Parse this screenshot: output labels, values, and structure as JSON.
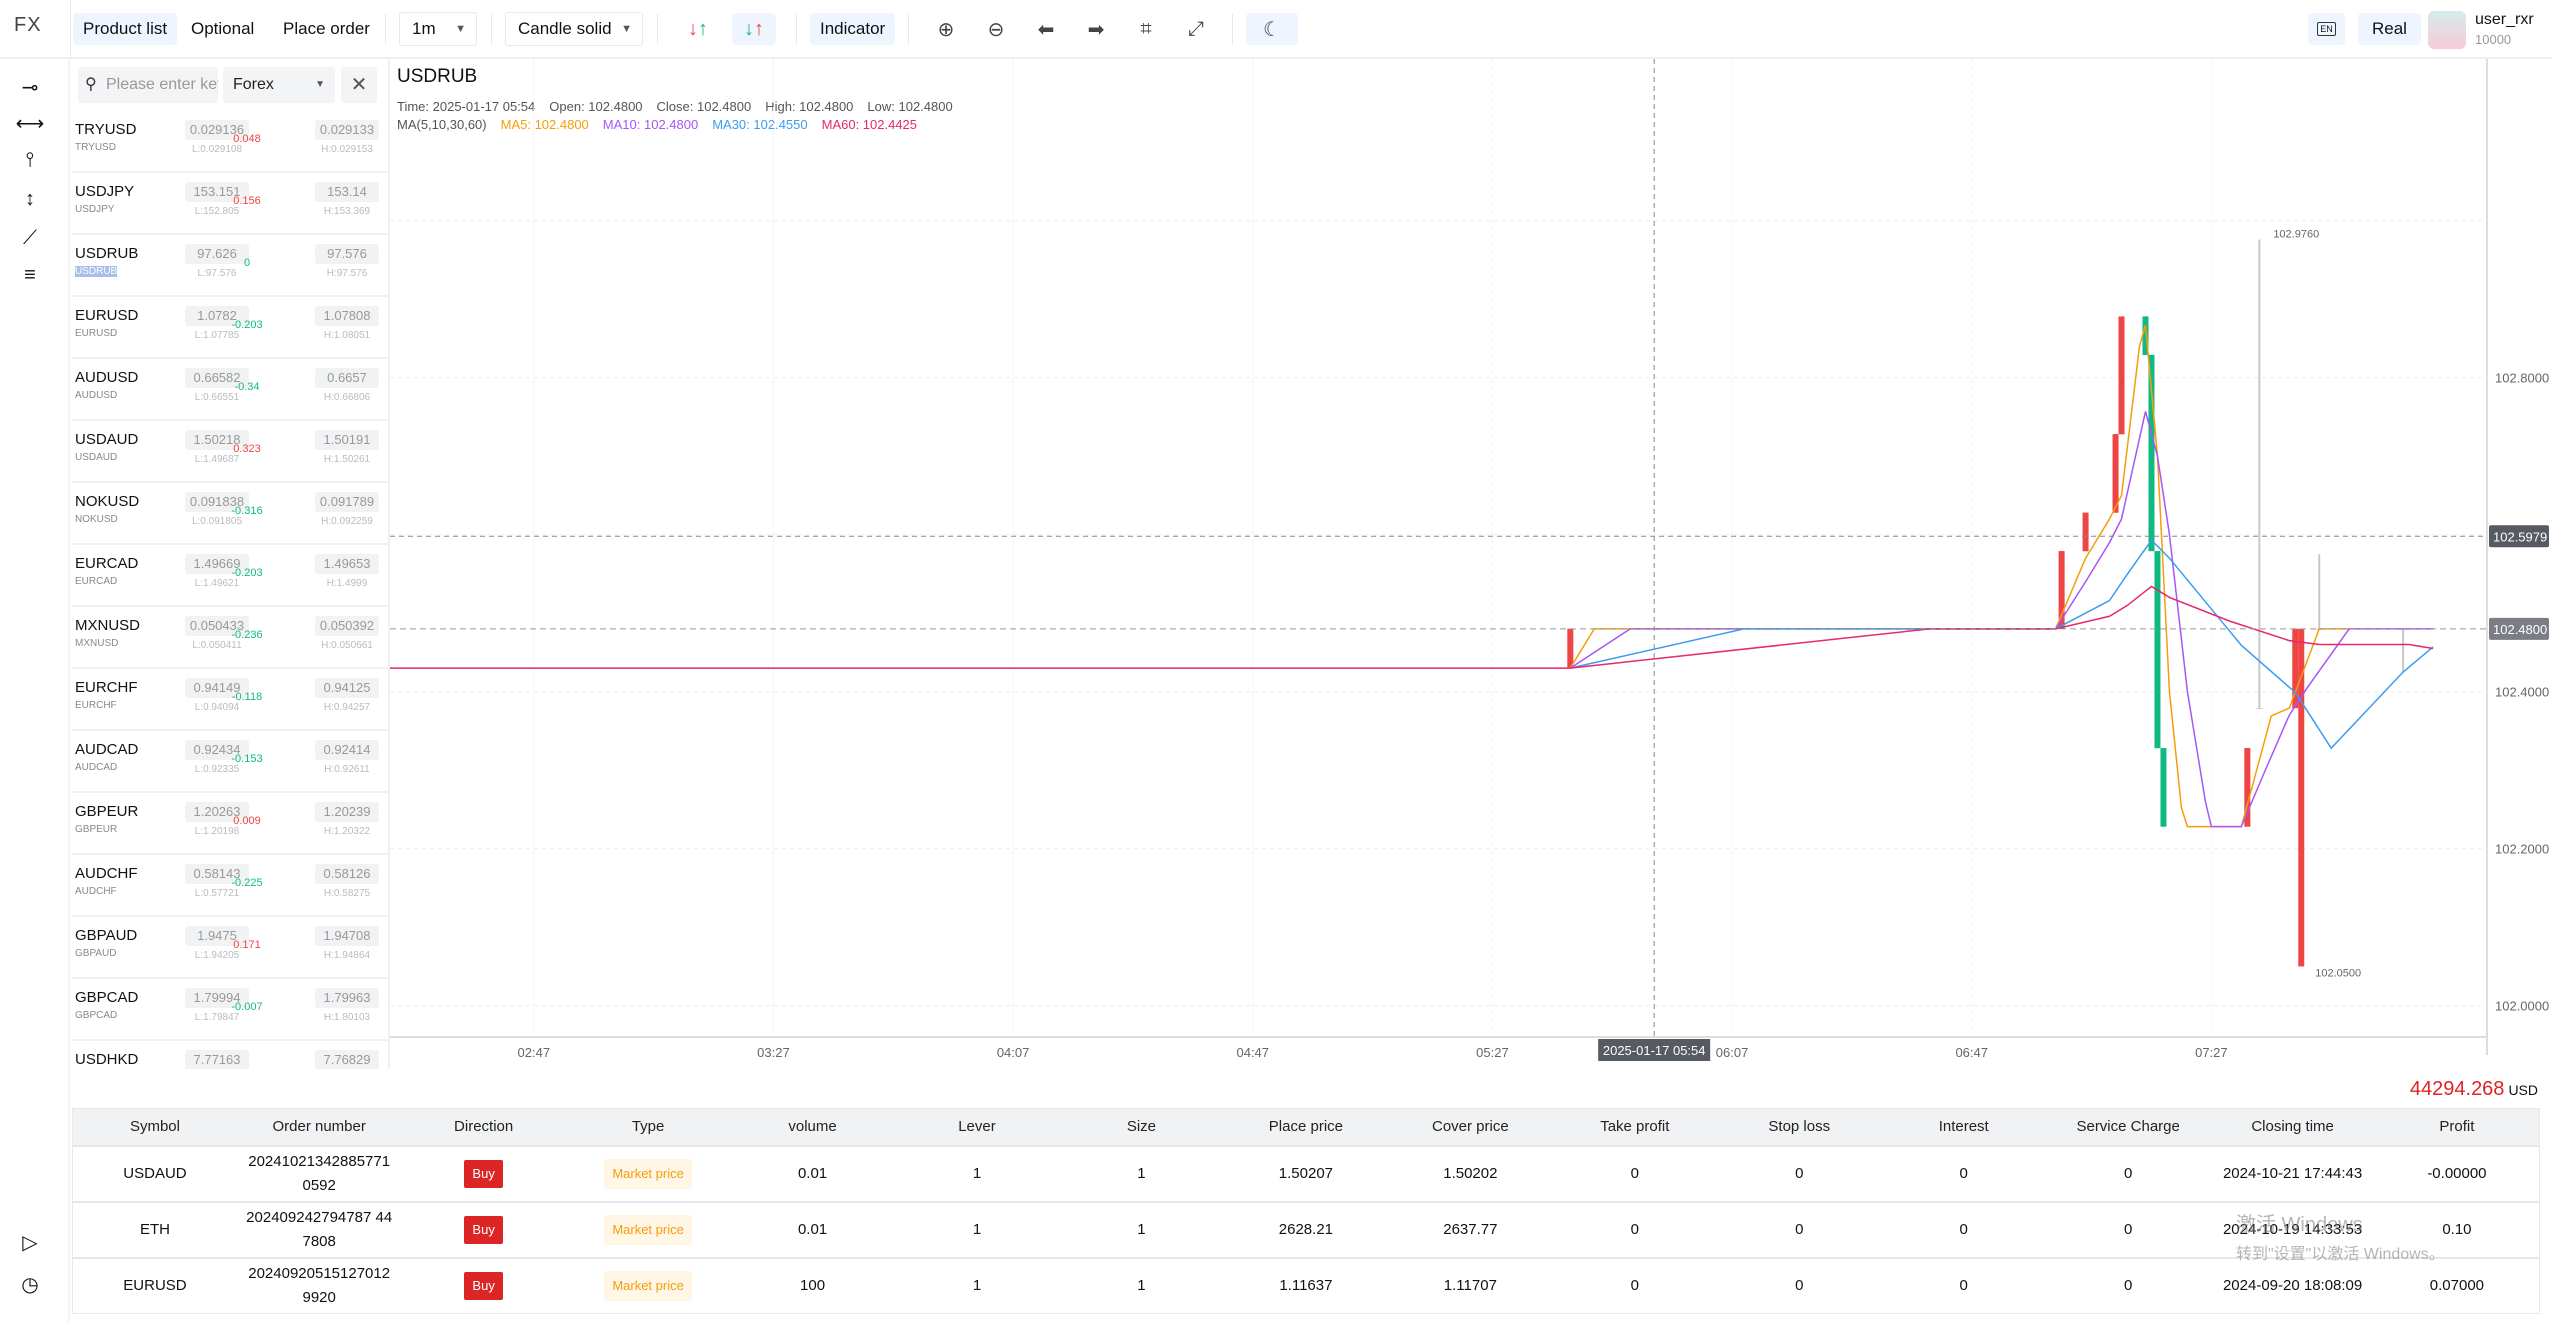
{
  "topbar": {
    "logo": "FX",
    "tabs": [
      {
        "label": "Product list",
        "active": true
      },
      {
        "label": "Optional",
        "active": false
      },
      {
        "label": "Place order",
        "active": false
      }
    ],
    "interval": "1m",
    "chart_style": "Candle solid",
    "indicator_label": "Indicator",
    "lang": "EN",
    "account_mode": "Real",
    "user": {
      "name": "user_rxr",
      "balance": "10000"
    }
  },
  "search": {
    "placeholder": "Please enter keyword",
    "category": "Forex"
  },
  "products": [
    {
      "name": "TRYUSD",
      "sub": "TRYUSD",
      "bid": "0.029136",
      "low": "L:0.029108",
      "change": "0.048",
      "ask": "0.029133",
      "high": "H:0.029153"
    },
    {
      "name": "USDJPY",
      "sub": "USDJPY",
      "bid": "153.151",
      "low": "L:152.805",
      "change": "0.156",
      "ask": "153.14",
      "high": "H:153.369"
    },
    {
      "name": "USDRUB",
      "sub": "USDRUB",
      "bid": "97.626",
      "low": "L:97.576",
      "change": "0",
      "ask": "97.576",
      "high": "H:97.576",
      "selected": true
    },
    {
      "name": "EURUSD",
      "sub": "EURUSD",
      "bid": "1.0782",
      "low": "L:1.07785",
      "change": "-0.203",
      "ask": "1.07808",
      "high": "H:1.08051"
    },
    {
      "name": "AUDUSD",
      "sub": "AUDUSD",
      "bid": "0.66582",
      "low": "L:0.66551",
      "change": "-0.34",
      "ask": "0.6657",
      "high": "H:0.66806"
    },
    {
      "name": "USDAUD",
      "sub": "USDAUD",
      "bid": "1.50218",
      "low": "L:1.49687",
      "change": "0.323",
      "ask": "1.50191",
      "high": "H:1.50261"
    },
    {
      "name": "NOKUSD",
      "sub": "NOKUSD",
      "bid": "0.091838",
      "low": "L:0.091805",
      "change": "-0.316",
      "ask": "0.091789",
      "high": "H:0.092259"
    },
    {
      "name": "EURCAD",
      "sub": "EURCAD",
      "bid": "1.49669",
      "low": "L:1.49621",
      "change": "-0.203",
      "ask": "1.49653",
      "high": "H:1.4999"
    },
    {
      "name": "MXNUSD",
      "sub": "MXNUSD",
      "bid": "0.050433",
      "low": "L:0.050411",
      "change": "-0.236",
      "ask": "0.050392",
      "high": "H:0.050661"
    },
    {
      "name": "EURCHF",
      "sub": "EURCHF",
      "bid": "0.94149",
      "low": "L:0.94094",
      "change": "-0.118",
      "ask": "0.94125",
      "high": "H:0.94257"
    },
    {
      "name": "AUDCAD",
      "sub": "AUDCAD",
      "bid": "0.92434",
      "low": "L:0.92335",
      "change": "-0.153",
      "ask": "0.92414",
      "high": "H:0.92611"
    },
    {
      "name": "GBPEUR",
      "sub": "GBPEUR",
      "bid": "1.20263",
      "low": "L:1.20198",
      "change": "0.009",
      "ask": "1.20239",
      "high": "H:1.20322"
    },
    {
      "name": "AUDCHF",
      "sub": "AUDCHF",
      "bid": "0.58143",
      "low": "L:0.57721",
      "change": "-0.225",
      "ask": "0.58126",
      "high": "H:0.58275"
    },
    {
      "name": "GBPAUD",
      "sub": "GBPAUD",
      "bid": "1.9475",
      "low": "L:1.94205",
      "change": "0.171",
      "ask": "1.94708",
      "high": "H:1.94864"
    },
    {
      "name": "GBPCAD",
      "sub": "GBPCAD",
      "bid": "1.79994",
      "low": "L:1.79847",
      "change": "-0.007",
      "ask": "1.79963",
      "high": "H:1.80103"
    },
    {
      "name": "USDHKD",
      "sub": "USDHKD",
      "bid": "7.77163",
      "low": "",
      "change": "",
      "ask": "7.76829",
      "high": ""
    }
  ],
  "colors": {
    "up": "#ef4444",
    "down": "#10b981",
    "ma5": "#f59e0b",
    "ma10": "#a855f7",
    "ma30": "#3b9cf0",
    "ma60": "#e6286e",
    "accent": "#eef5ff"
  },
  "chart": {
    "symbol": "USDRUB",
    "info": {
      "time": "Time: 2025-01-17 05:54",
      "open": "Open: 102.4800",
      "close": "Close: 102.4800",
      "high": "High: 102.4800",
      "low": "Low: 102.4800"
    },
    "ma": {
      "label": "MA(5,10,30,60)",
      "ma5": "MA5: 102.4800",
      "ma10": "MA10: 102.4800",
      "ma30": "MA30: 102.4550",
      "ma60": "MA60: 102.4425"
    }
  },
  "chart_data": {
    "type": "candlestick",
    "xlim": [
      "02:23",
      "08:13"
    ],
    "ylim": [
      101.96,
      103.206
    ],
    "grid": true,
    "x_ticks": [
      "02:47",
      "03:27",
      "04:07",
      "04:47",
      "05:27",
      "06:07",
      "06:47",
      "07:27"
    ],
    "y_ticks": [
      "102.8000",
      "102.4000",
      "102.2000",
      "102.0000"
    ],
    "crosshair": {
      "time_label": "2025-01-17 05:54",
      "price_label": "102.5979",
      "price": 102.5979,
      "time": "05:54"
    },
    "last_price": {
      "label": "102.4800",
      "value": 102.48
    },
    "max_label": "102.9760",
    "min_label": "102.0500",
    "candles": [
      {
        "t": "05:40",
        "o": 102.43,
        "h": 102.48,
        "l": 102.43,
        "c": 102.48
      },
      {
        "t": "07:02",
        "o": 102.48,
        "h": 102.579,
        "l": 102.48,
        "c": 102.579
      },
      {
        "t": "07:06",
        "o": 102.579,
        "h": 102.628,
        "l": 102.579,
        "c": 102.628
      },
      {
        "t": "07:11",
        "o": 102.628,
        "h": 102.728,
        "l": 102.628,
        "c": 102.728
      },
      {
        "t": "07:12",
        "o": 102.728,
        "h": 102.878,
        "l": 102.728,
        "c": 102.878
      },
      {
        "t": "07:16",
        "o": 102.878,
        "h": 102.878,
        "l": 102.829,
        "c": 102.829
      },
      {
        "t": "07:17",
        "o": 102.829,
        "h": 102.829,
        "l": 102.579,
        "c": 102.579
      },
      {
        "t": "07:18",
        "o": 102.579,
        "h": 102.579,
        "l": 102.328,
        "c": 102.328
      },
      {
        "t": "07:19",
        "o": 102.328,
        "h": 102.328,
        "l": 102.228,
        "c": 102.228
      },
      {
        "t": "07:33",
        "o": 102.228,
        "h": 102.328,
        "l": 102.228,
        "c": 102.328
      },
      {
        "t": "07:35",
        "o": 102.379,
        "h": 102.976,
        "l": 102.379,
        "c": 102.379
      },
      {
        "t": "07:41",
        "o": 102.379,
        "h": 102.48,
        "l": 102.379,
        "c": 102.48
      },
      {
        "t": "07:42",
        "o": 102.05,
        "h": 102.48,
        "l": 102.05,
        "c": 102.48
      },
      {
        "t": "07:45",
        "o": 102.48,
        "h": 102.575,
        "l": 102.48,
        "c": 102.48
      },
      {
        "t": "07:59",
        "o": 102.48,
        "h": 102.48,
        "l": 102.425,
        "c": 102.48
      }
    ],
    "series": [
      {
        "name": "MA5",
        "color_key": "ma5",
        "points": [
          [
            "05:40",
            102.43
          ],
          [
            "05:44",
            102.48
          ],
          [
            "07:01",
            102.48
          ],
          [
            "07:06",
            102.57
          ],
          [
            "07:10",
            102.62
          ],
          [
            "07:12",
            102.65
          ],
          [
            "07:15",
            102.84
          ],
          [
            "07:16",
            102.867
          ],
          [
            "07:18",
            102.7
          ],
          [
            "07:20",
            102.4
          ],
          [
            "07:22",
            102.252
          ],
          [
            "07:23",
            102.228
          ],
          [
            "07:32",
            102.228
          ],
          [
            "07:37",
            102.369
          ],
          [
            "07:40",
            102.379
          ],
          [
            "07:45",
            102.48
          ],
          [
            "07:50",
            102.48
          ]
        ]
      },
      {
        "name": "MA10",
        "color_key": "ma10",
        "points": [
          [
            "05:40",
            102.43
          ],
          [
            "05:50",
            102.48
          ],
          [
            "07:01",
            102.48
          ],
          [
            "07:06",
            102.54
          ],
          [
            "07:10",
            102.59
          ],
          [
            "07:12",
            102.62
          ],
          [
            "07:16",
            102.757
          ],
          [
            "07:18",
            102.7
          ],
          [
            "07:20",
            102.6
          ],
          [
            "07:23",
            102.4
          ],
          [
            "07:26",
            102.26
          ],
          [
            "07:27",
            102.228
          ],
          [
            "07:32",
            102.228
          ],
          [
            "07:36",
            102.3
          ],
          [
            "07:40",
            102.37
          ],
          [
            "07:43",
            102.405
          ],
          [
            "07:50",
            102.48
          ],
          [
            "08:04",
            102.48
          ]
        ]
      },
      {
        "name": "MA30",
        "color_key": "ma30",
        "points": [
          [
            "05:40",
            102.43
          ],
          [
            "06:09",
            102.48
          ],
          [
            "07:01",
            102.48
          ],
          [
            "07:10",
            102.516
          ],
          [
            "07:13",
            102.55
          ],
          [
            "07:17",
            102.593
          ],
          [
            "07:20",
            102.57
          ],
          [
            "07:32",
            102.459
          ],
          [
            "07:41",
            102.399
          ],
          [
            "07:47",
            102.328
          ],
          [
            "07:59",
            102.425
          ],
          [
            "08:04",
            102.457
          ]
        ]
      },
      {
        "name": "MA60",
        "color_key": "ma60",
        "points": [
          [
            "02:23",
            102.43
          ],
          [
            "05:40",
            102.43
          ],
          [
            "06:40",
            102.48
          ],
          [
            "07:01",
            102.48
          ],
          [
            "07:10",
            102.496
          ],
          [
            "07:13",
            102.51
          ],
          [
            "07:17",
            102.534
          ],
          [
            "07:20",
            102.52
          ],
          [
            "07:30",
            102.49
          ],
          [
            "07:40",
            102.465
          ],
          [
            "07:45",
            102.46
          ],
          [
            "08:00",
            102.46
          ],
          [
            "08:04",
            102.455
          ]
        ]
      }
    ]
  },
  "balance": {
    "value": "44294.268",
    "currency": "USD"
  },
  "orders": {
    "columns": [
      "Symbol",
      "Order number",
      "Direction",
      "Type",
      "volume",
      "Lever",
      "Size",
      "Place price",
      "Cover price",
      "Take profit",
      "Stop loss",
      "Interest",
      "Service Charge",
      "Closing time",
      "Profit"
    ],
    "rows": [
      {
        "symbol": "USDAUD",
        "order": "20241021342885771 0592",
        "direction": "Buy",
        "type": "Market price",
        "volume": "0.01",
        "lever": "1",
        "size": "1",
        "place": "1.50207",
        "cover": "1.50202",
        "tp": "0",
        "sl": "0",
        "interest": "0",
        "service": "0",
        "closing": "2024-10-21 17:44:43",
        "profit": "-0.00000"
      },
      {
        "symbol": "ETH",
        "order": "202409242794787 447808",
        "direction": "Buy",
        "type": "Market price",
        "volume": "0.01",
        "lever": "1",
        "size": "1",
        "place": "2628.21",
        "cover": "2637.77",
        "tp": "0",
        "sl": "0",
        "interest": "0",
        "service": "0",
        "closing": "2024-10-19 14:33:53",
        "profit": "0.10"
      },
      {
        "symbol": "EURUSD",
        "order": "20240920515127012 9920",
        "direction": "Buy",
        "type": "Market price",
        "volume": "100",
        "lever": "1",
        "size": "1",
        "place": "1.11637",
        "cover": "1.11707",
        "tp": "0",
        "sl": "0",
        "interest": "0",
        "service": "0",
        "closing": "2024-09-20 18:08:09",
        "profit": "0.07000"
      }
    ]
  },
  "watermark": {
    "line1": "激活 Windows",
    "line2": "转到\"设置\"以激活 Windows。"
  }
}
